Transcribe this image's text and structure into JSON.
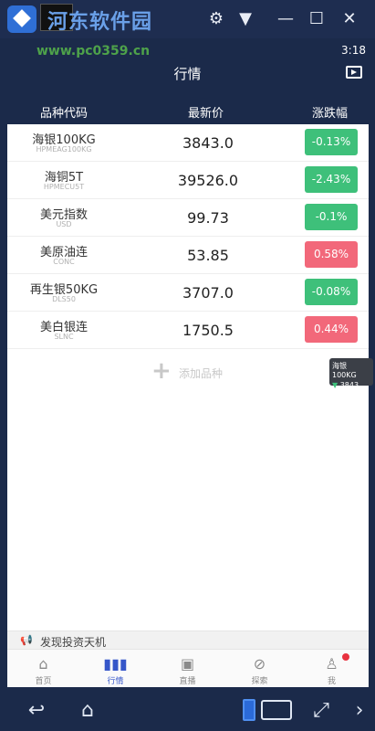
{
  "emulator": {
    "watermark_title": "河东软件园",
    "watermark_url": "www.pc0359.cn",
    "controls": [
      "minimize-icon",
      "maximize-icon",
      "close-icon"
    ]
  },
  "status": {
    "time": "3:18"
  },
  "header": {
    "title": "行情"
  },
  "columns": {
    "name": "品种代码",
    "price": "最新价",
    "change": "涨跌幅"
  },
  "rows": [
    {
      "name": "海银100KG",
      "code": "HPMEAG100KG",
      "price": "3843.0",
      "change": "-0.13%",
      "direction": "down"
    },
    {
      "name": "海铜5T",
      "code": "HPMECU5T",
      "price": "39526.0",
      "change": "-2.43%",
      "direction": "down"
    },
    {
      "name": "美元指数",
      "code": "USD",
      "price": "99.73",
      "change": "-0.1%",
      "direction": "down"
    },
    {
      "name": "美原油连",
      "code": "CONC",
      "price": "53.85",
      "change": "0.58%",
      "direction": "up"
    },
    {
      "name": "再生银50KG",
      "code": "DLS50",
      "price": "3707.0",
      "change": "-0.08%",
      "direction": "down"
    },
    {
      "name": "美白银连",
      "code": "SLNC",
      "price": "1750.5",
      "change": "0.44%",
      "direction": "up"
    }
  ],
  "add": {
    "label": "添加品种"
  },
  "float_tip": {
    "name": "海银100KG",
    "value": "3843"
  },
  "discover": {
    "label": "发现投资天机"
  },
  "tabs": [
    {
      "label": "首页",
      "icon": "home-icon"
    },
    {
      "label": "行情",
      "icon": "chart-icon",
      "active": true
    },
    {
      "label": "直播",
      "icon": "live-tv-icon"
    },
    {
      "label": "探索",
      "icon": "compass-icon"
    },
    {
      "label": "我",
      "icon": "user-icon",
      "badge": true
    }
  ],
  "colors": {
    "down": "#3ec07a",
    "up": "#f2687a",
    "header": "#1b2a4a",
    "active_tab": "#3556c9"
  }
}
